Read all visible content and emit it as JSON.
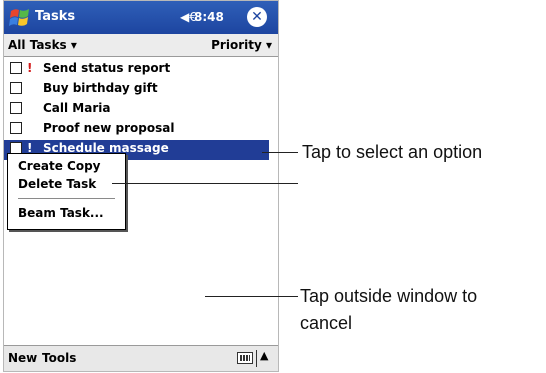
{
  "titlebar": {
    "app_title": "Tasks",
    "logo_icon": "windows-flag-icon",
    "speaker_icon": "speaker-icon",
    "time": "8:48",
    "close_icon": "close-icon"
  },
  "filterbar": {
    "filter_label": "All Tasks ▾",
    "sort_label": "Priority ▾"
  },
  "tasks": [
    {
      "priority": "!",
      "label": "Send status report",
      "selected": false
    },
    {
      "priority": "",
      "label": "Buy birthday gift",
      "selected": false
    },
    {
      "priority": "",
      "label": "Call Maria",
      "selected": false
    },
    {
      "priority": "",
      "label": "Proof new proposal",
      "selected": false
    },
    {
      "priority": "!",
      "label": "Schedule massage",
      "selected": true
    }
  ],
  "context_menu": {
    "items": [
      "Create Copy",
      "Delete Task",
      "Beam Task..."
    ]
  },
  "commandbar": {
    "new_label": "New",
    "tools_label": "Tools",
    "keyboard_icon": "keyboard-icon",
    "sip_arrow": "▲"
  },
  "callouts": {
    "select_option": "Tap to select an option",
    "cancel_line1": "Tap outside window to",
    "cancel_line2": "cancel"
  },
  "colors": {
    "titlebar": "#1d45a0",
    "selection": "#213d96",
    "priority": "#d21a1a"
  }
}
